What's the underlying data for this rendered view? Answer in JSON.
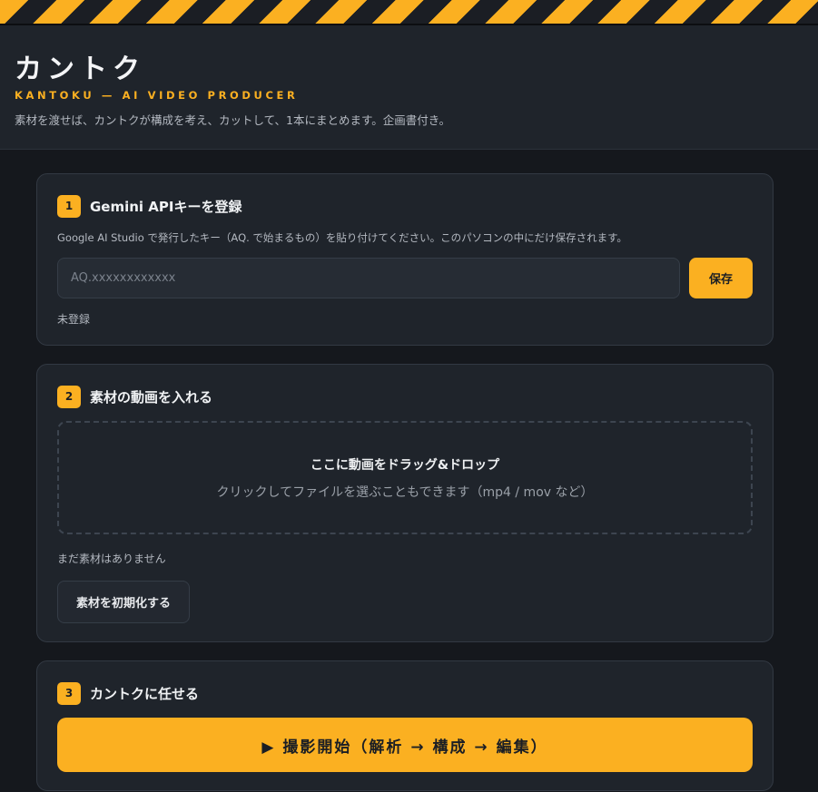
{
  "header": {
    "title": "カントク",
    "subtitle": "KANTOKU — AI VIDEO PRODUCER",
    "tagline": "素材を渡せば、カントクが構成を考え、カットして、1本にまとめます。企画書付き。"
  },
  "step1": {
    "number": "1",
    "title": "Gemini APIキーを登録",
    "description": "Google AI Studio で発行したキー（AQ. で始まるもの）を貼り付けてください。このパソコンの中にだけ保存されます。",
    "input_placeholder": "AQ.xxxxxxxxxxxx",
    "save_label": "保存",
    "status": "未登録"
  },
  "step2": {
    "number": "2",
    "title": "素材の動画を入れる",
    "drop_title": "ここに動画をドラッグ&ドロップ",
    "drop_subtitle": "クリックしてファイルを選ぶこともできます（mp4 / mov など）",
    "empty_text": "まだ素材はありません",
    "reset_label": "素材を初期化する"
  },
  "step3": {
    "number": "3",
    "title": "カントクに任せる",
    "start_label": "▶ 撮影開始（解析 → 構成 → 編集）"
  },
  "colors": {
    "accent": "#fbb021",
    "background": "#15181d",
    "card": "#1f242b"
  }
}
